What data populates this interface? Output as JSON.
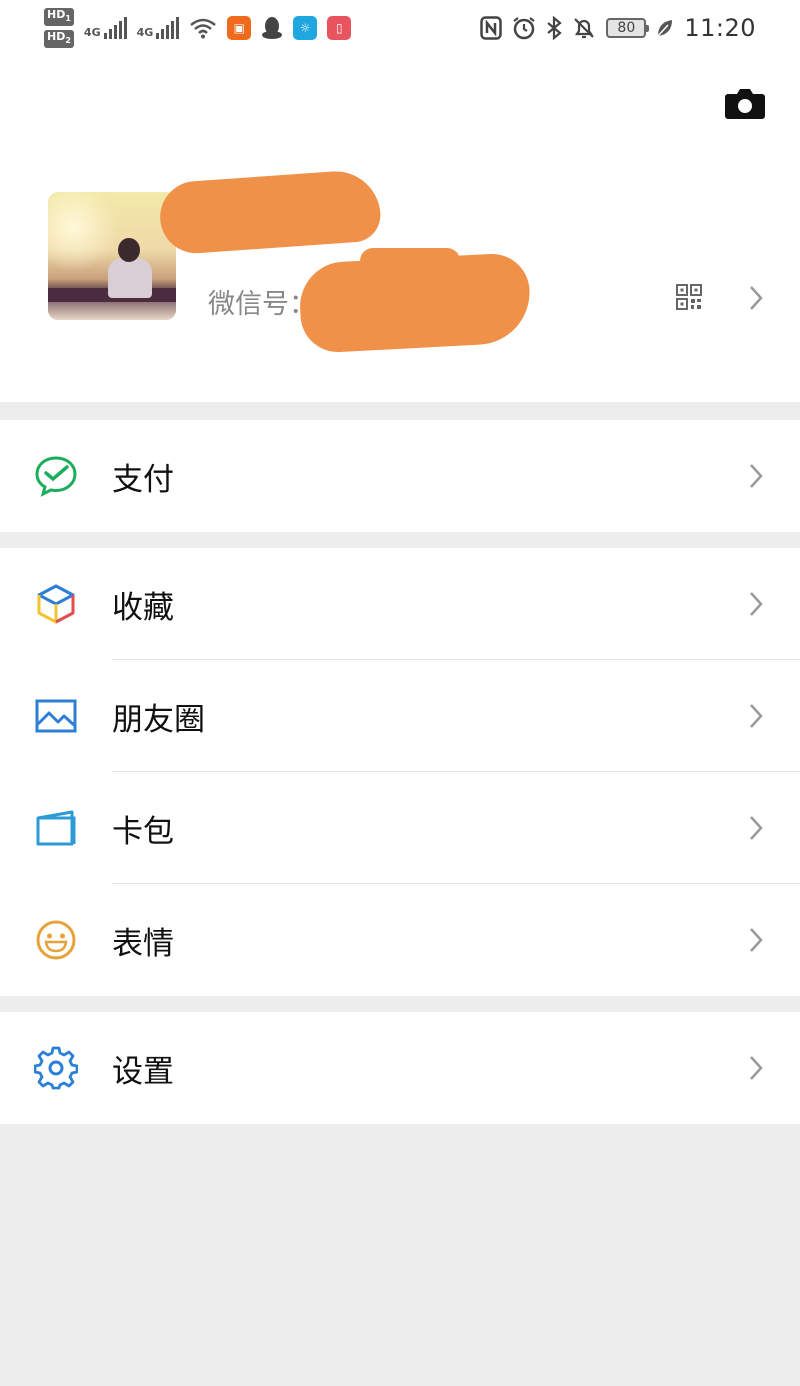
{
  "status_bar": {
    "hd1": "HD",
    "hd1_sub": "1",
    "hd2": "HD",
    "hd2_sub": "2",
    "net1": "4G",
    "net2": "4G",
    "battery": "80",
    "time": "11:20"
  },
  "profile": {
    "wechat_id_label": "微信号：li"
  },
  "menu": {
    "pay": "支付",
    "favorites": "收藏",
    "moments": "朋友圈",
    "cards": "卡包",
    "stickers": "表情",
    "settings": "设置"
  },
  "colors": {
    "pay_green": "#1aad5b",
    "settings_blue": "#2c7fd6",
    "sticker_orange": "#e8a23c",
    "redaction": "#f0914a",
    "background": "#ededed"
  },
  "icons": {
    "pay": "wechat-pay-icon",
    "favorites": "cube-icon",
    "moments": "landscape-icon",
    "cards": "card-wallet-icon",
    "stickers": "smiley-icon",
    "settings": "gear-icon"
  }
}
